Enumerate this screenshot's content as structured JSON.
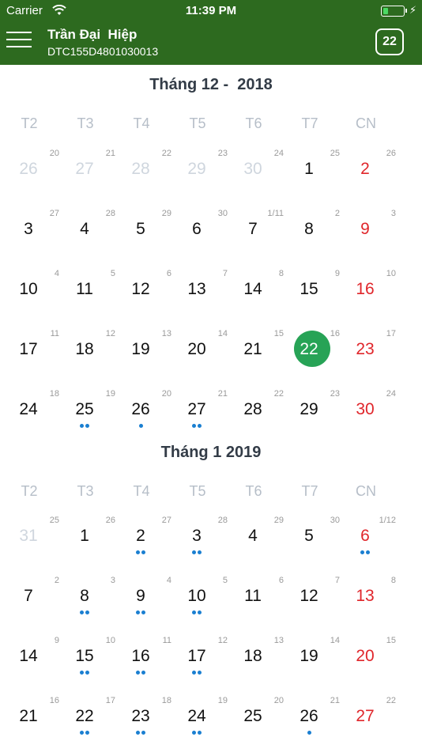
{
  "status_bar": {
    "carrier": "Carrier",
    "time": "11:39 PM",
    "battery_level": 0.25,
    "icons": [
      "wifi-icon",
      "battery-icon",
      "charging-bolt-icon"
    ]
  },
  "header": {
    "name": "Trần Đại  Hiệp",
    "code": "DTC155D4801030013",
    "today_label": "22",
    "icons": [
      "menu-icon"
    ],
    "colors": {
      "background": "#2d6a1f",
      "text": "#ffffff"
    }
  },
  "colors": {
    "sunday": "#e0262b",
    "today_circle": "#27a356",
    "event_dot": "#1a7fd1",
    "other_month": "#cfd6de",
    "weekday_label": "#b6bec8",
    "lunar": "#9a9a9a"
  },
  "months": [
    {
      "title": "Tháng 12 -  2018",
      "weekdays": [
        "T2",
        "T3",
        "T4",
        "T5",
        "T6",
        "T7",
        "CN"
      ],
      "weeks": [
        [
          {
            "solar": "26",
            "lunar": "20",
            "other": true
          },
          {
            "solar": "27",
            "lunar": "21",
            "other": true
          },
          {
            "solar": "28",
            "lunar": "22",
            "other": true
          },
          {
            "solar": "29",
            "lunar": "23",
            "other": true
          },
          {
            "solar": "30",
            "lunar": "24",
            "other": true
          },
          {
            "solar": "1",
            "lunar": "25"
          },
          {
            "solar": "2",
            "lunar": "26"
          }
        ],
        [
          {
            "solar": "3",
            "lunar": "27"
          },
          {
            "solar": "4",
            "lunar": "28"
          },
          {
            "solar": "5",
            "lunar": "29"
          },
          {
            "solar": "6",
            "lunar": "30"
          },
          {
            "solar": "7",
            "lunar": "1/11"
          },
          {
            "solar": "8",
            "lunar": "2"
          },
          {
            "solar": "9",
            "lunar": "3"
          }
        ],
        [
          {
            "solar": "10",
            "lunar": "4"
          },
          {
            "solar": "11",
            "lunar": "5"
          },
          {
            "solar": "12",
            "lunar": "6"
          },
          {
            "solar": "13",
            "lunar": "7"
          },
          {
            "solar": "14",
            "lunar": "8"
          },
          {
            "solar": "15",
            "lunar": "9"
          },
          {
            "solar": "16",
            "lunar": "10"
          }
        ],
        [
          {
            "solar": "17",
            "lunar": "11"
          },
          {
            "solar": "18",
            "lunar": "12"
          },
          {
            "solar": "19",
            "lunar": "13"
          },
          {
            "solar": "20",
            "lunar": "14"
          },
          {
            "solar": "21",
            "lunar": "15"
          },
          {
            "solar": "22",
            "lunar": "16",
            "today": true
          },
          {
            "solar": "23",
            "lunar": "17"
          }
        ],
        [
          {
            "solar": "24",
            "lunar": "18"
          },
          {
            "solar": "25",
            "lunar": "19",
            "dots": 2
          },
          {
            "solar": "26",
            "lunar": "20",
            "dots": 1
          },
          {
            "solar": "27",
            "lunar": "21",
            "dots": 2
          },
          {
            "solar": "28",
            "lunar": "22"
          },
          {
            "solar": "29",
            "lunar": "23"
          },
          {
            "solar": "30",
            "lunar": "24"
          }
        ]
      ]
    },
    {
      "title": "Tháng 1 2019",
      "weekdays": [
        "T2",
        "T3",
        "T4",
        "T5",
        "T6",
        "T7",
        "CN"
      ],
      "weeks": [
        [
          {
            "solar": "31",
            "lunar": "25",
            "other": true
          },
          {
            "solar": "1",
            "lunar": "26"
          },
          {
            "solar": "2",
            "lunar": "27",
            "dots": 2
          },
          {
            "solar": "3",
            "lunar": "28",
            "dots": 2
          },
          {
            "solar": "4",
            "lunar": "29"
          },
          {
            "solar": "5",
            "lunar": "30"
          },
          {
            "solar": "6",
            "lunar": "1/12",
            "dots": 2
          }
        ],
        [
          {
            "solar": "7",
            "lunar": "2"
          },
          {
            "solar": "8",
            "lunar": "3",
            "dots": 2
          },
          {
            "solar": "9",
            "lunar": "4",
            "dots": 2
          },
          {
            "solar": "10",
            "lunar": "5",
            "dots": 2
          },
          {
            "solar": "11",
            "lunar": "6"
          },
          {
            "solar": "12",
            "lunar": "7"
          },
          {
            "solar": "13",
            "lunar": "8"
          }
        ],
        [
          {
            "solar": "14",
            "lunar": "9"
          },
          {
            "solar": "15",
            "lunar": "10",
            "dots": 2
          },
          {
            "solar": "16",
            "lunar": "11",
            "dots": 2
          },
          {
            "solar": "17",
            "lunar": "12",
            "dots": 2
          },
          {
            "solar": "18",
            "lunar": "13"
          },
          {
            "solar": "19",
            "lunar": "14"
          },
          {
            "solar": "20",
            "lunar": "15"
          }
        ],
        [
          {
            "solar": "21",
            "lunar": "16"
          },
          {
            "solar": "22",
            "lunar": "17",
            "dots": 2
          },
          {
            "solar": "23",
            "lunar": "18",
            "dots": 2
          },
          {
            "solar": "24",
            "lunar": "19",
            "dots": 2
          },
          {
            "solar": "25",
            "lunar": "20"
          },
          {
            "solar": "26",
            "lunar": "21",
            "dots": 1
          },
          {
            "solar": "27",
            "lunar": "22"
          }
        ]
      ]
    }
  ]
}
